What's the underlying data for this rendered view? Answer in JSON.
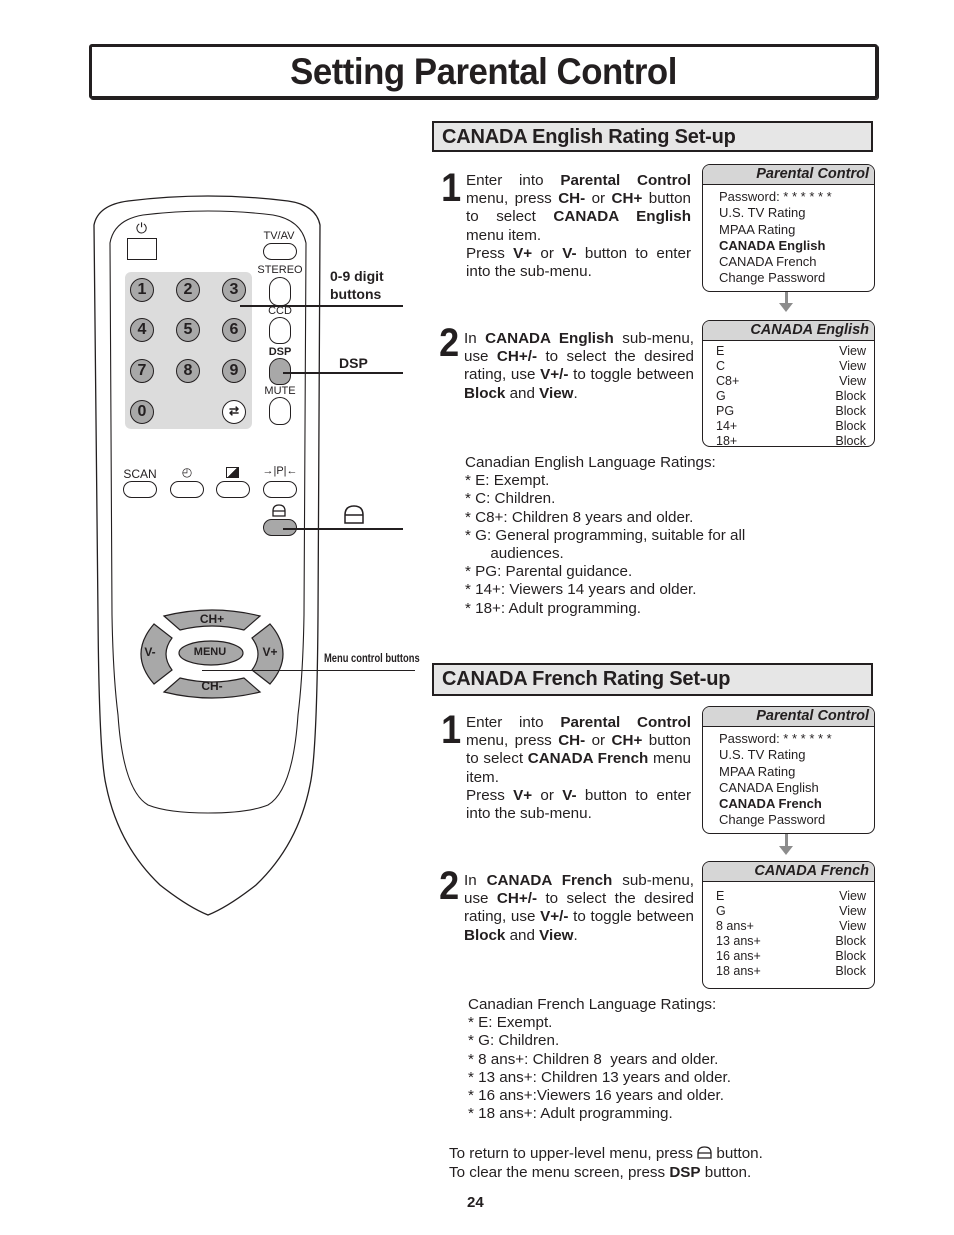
{
  "page": {
    "title": "Setting Parental Control",
    "page_number": "24"
  },
  "remote": {
    "power_icon": "power-icon",
    "tv_av": "TV/AV",
    "stereo": "STEREO",
    "ccd": "CCD",
    "dsp": "DSP",
    "mute": "MUTE",
    "digits": [
      "1",
      "2",
      "3",
      "4",
      "5",
      "6",
      "7",
      "8",
      "9",
      "0"
    ],
    "recall_icon": "recall-icon",
    "scan": "SCAN",
    "sleep_icon": "clock-icon",
    "picture_icon": "picture-mode-icon",
    "pp_label": "→|P|←",
    "return_icon": "return-icon",
    "ch_plus": "CH+",
    "ch_minus": "CH-",
    "v_minus": "V-",
    "v_plus": "V+",
    "menu": "MENU"
  },
  "callouts": {
    "digit_buttons_line1": "0-9 digit",
    "digit_buttons_line2": "buttons",
    "dsp": "DSP",
    "menu_control": "Menu control buttons"
  },
  "english": {
    "header": "CANADA English Rating Set-up",
    "step1": {
      "number": "1",
      "t1": "Enter into ",
      "b1": "Parental Control",
      "t2": " menu, press ",
      "b2": "CH-",
      "t3": " or ",
      "b3": "CH+",
      "t4": " button to select ",
      "b4": "CANADA English",
      "t5": " menu item.",
      "t6": "Press ",
      "b5": "V+",
      "t7": " or ",
      "b6": "V-",
      "t8": " button to enter into the sub-menu."
    },
    "menu": {
      "title": "Parental Control",
      "items": [
        "Password: * * * * * *",
        "U.S. TV Rating",
        "MPAA Rating",
        "CANADA English",
        "CANADA French",
        "Change Password"
      ],
      "selected_index": 3
    },
    "step2": {
      "number": "2",
      "t1": "In ",
      "b1": "CANADA English",
      "t2": " sub-menu, use ",
      "b2": "CH+/-",
      "t3": " to select the desired rating, use ",
      "b3": "V+/-",
      "t4": " to toggle between ",
      "b4": "Block",
      "t5": " and ",
      "b5": "View",
      "t6": "."
    },
    "submenu": {
      "title": "CANADA English",
      "rows": [
        {
          "rating": "E",
          "status": "View"
        },
        {
          "rating": "C",
          "status": "View"
        },
        {
          "rating": "C8+",
          "status": "View"
        },
        {
          "rating": "G",
          "status": "Block"
        },
        {
          "rating": "PG",
          "status": "Block"
        },
        {
          "rating": "14+",
          "status": "Block"
        },
        {
          "rating": "18+",
          "status": "Block"
        }
      ]
    },
    "notes": [
      "Canadian English Language Ratings:",
      "* E: Exempt.",
      "* C: Children.",
      "* C8+: Children 8 years and older.",
      "* G: General programming, suitable for all",
      "      audiences.",
      "* PG: Parental guidance.",
      "* 14+: Viewers 14 years and older.",
      "* 18+: Adult programming."
    ]
  },
  "french": {
    "header": "CANADA French Rating Set-up",
    "step1": {
      "number": "1",
      "t1": "Enter into ",
      "b1": "Parental Control",
      "t2": " menu, press ",
      "b2": "CH-",
      "t3": " or ",
      "b3": "CH+",
      "t4": " button to select ",
      "b4": "CANADA French",
      "t5": " menu item.",
      "t6": "Press ",
      "b5": "V+",
      "t7": " or ",
      "b6": "V-",
      "t8": " button to enter into the sub-menu."
    },
    "menu": {
      "title": "Parental Control",
      "items": [
        "Password: * * * * * *",
        "U.S. TV Rating",
        "MPAA Rating",
        "CANADA English",
        "CANADA French",
        "Change Password"
      ],
      "selected_index": 4
    },
    "step2": {
      "number": "2",
      "t1": "In ",
      "b1": "CANADA French",
      "t2": " sub-menu, use ",
      "b2": "CH+/-",
      "t3": " to select the desired rating, use ",
      "b3": "V+/-",
      "t4": " to toggle between ",
      "b4": "Block",
      "t5": " and ",
      "b5": "View",
      "t6": "."
    },
    "submenu": {
      "title": "CANADA French",
      "rows": [
        {
          "rating": "E",
          "status": "View"
        },
        {
          "rating": "G",
          "status": "View"
        },
        {
          "rating": "8 ans+",
          "status": "View"
        },
        {
          "rating": "13 ans+",
          "status": "Block"
        },
        {
          "rating": "16 ans+",
          "status": "Block"
        },
        {
          "rating": "18 ans+",
          "status": "Block"
        }
      ]
    },
    "notes": [
      "Canadian French Language Ratings:",
      "* E: Exempt.",
      "* G: Children.",
      "* 8 ans+: Children 8  years and older.",
      "* 13 ans+: Children 13 years and older.",
      "* 16 ans+:Viewers 16 years and older.",
      "* 18 ans+: Adult programming."
    ]
  },
  "footer": {
    "line1_a": "To return to upper-level menu, press ",
    "line1_icon": "return-icon",
    "line1_b": " button.",
    "line2_a": "To clear the menu screen, press ",
    "line2_bold": "DSP",
    "line2_b": " button."
  }
}
